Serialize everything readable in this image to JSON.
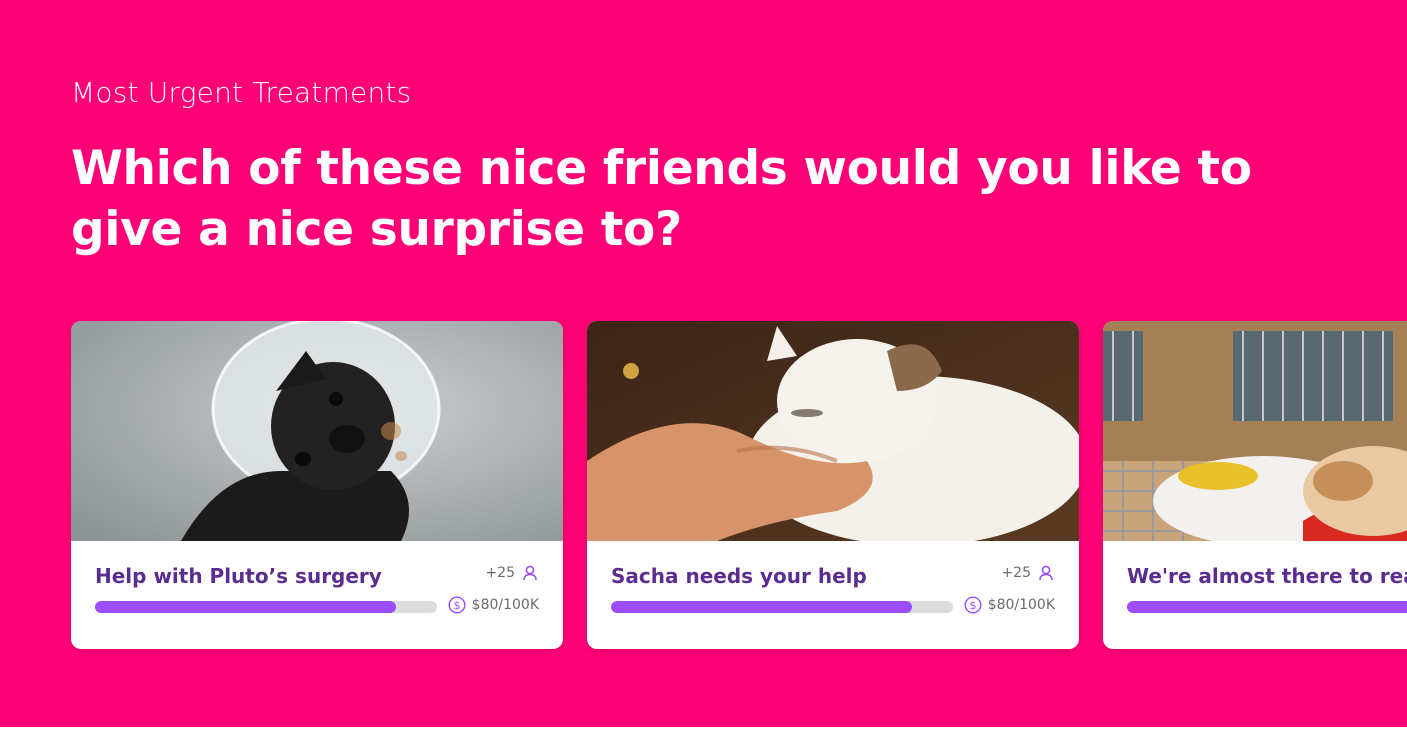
{
  "section": {
    "eyebrow": "Most Urgent Treatments",
    "headline": "Which of these nice friends would you like to give a nice surprise to?"
  },
  "colors": {
    "background": "#ff0077",
    "title": "#5b2d90",
    "progress_fill": "#9b4dff",
    "progress_track": "#dcdcdc",
    "icon": "#9b4dff"
  },
  "cards": [
    {
      "image": "pug-with-cone-photo",
      "title": "Help with Pluto’s surgery",
      "supporters": "+25",
      "supporters_icon": "user-icon",
      "raised": "$80/100K",
      "raised_icon": "dollar-icon",
      "progress": 0.88
    },
    {
      "image": "cat-being-petted-photo",
      "title": "Sacha needs your help",
      "supporters": "+25",
      "supporters_icon": "user-icon",
      "raised": "$80/100K",
      "raised_icon": "dollar-icon",
      "progress": 0.88
    },
    {
      "image": "puppy-in-kennel-photo",
      "title": "We're almost there to reach",
      "progress": 0.88
    }
  ]
}
